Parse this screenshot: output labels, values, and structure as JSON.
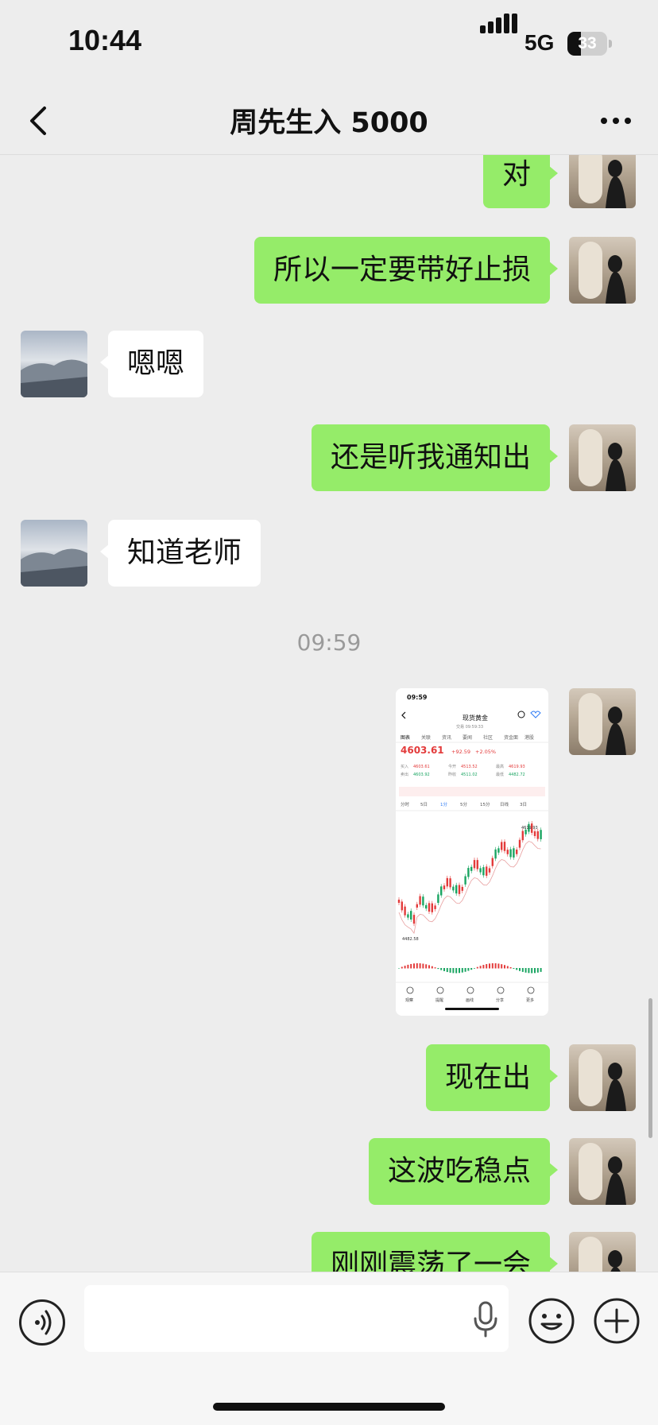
{
  "status_bar": {
    "time": "10:44",
    "network": "5G",
    "battery": "33",
    "battery_level": 0.33
  },
  "nav": {
    "title": "周先生入 5000"
  },
  "messages": [
    {
      "side": "out",
      "text": "对"
    },
    {
      "side": "out",
      "text": "所以一定要带好止损"
    },
    {
      "side": "in",
      "text": "嗯嗯"
    },
    {
      "side": "out",
      "text": "还是听我通知出"
    },
    {
      "side": "in",
      "text": "知道老师"
    },
    {
      "side": "out",
      "text": "现在出"
    },
    {
      "side": "out",
      "text": "这波吃稳点"
    },
    {
      "side": "out",
      "text": "刚刚震荡了一会"
    }
  ],
  "timestamp": "09:59",
  "screenshot": {
    "status_time": "09:59",
    "title": "现货黄金",
    "subtitle": "交易 09:59:33",
    "tabs": [
      "图表",
      "关联",
      "资讯",
      "要闻",
      "社区",
      "资金面",
      "港股"
    ],
    "price": "4603.61",
    "change": "+92.59",
    "change_pct": "+2.05%",
    "quote_labels": [
      "买入",
      "卖出",
      "今开",
      "昨收",
      "最高",
      "最低"
    ],
    "quote_values": [
      "4603.61",
      "4603.92",
      "4513.52",
      "4511.02",
      "4619.93",
      "4482.72"
    ],
    "periods": [
      "分时",
      "5日",
      "1分",
      "5分",
      "15分",
      "日线",
      "3日"
    ],
    "high_label": "4619.93",
    "low_label": "4482.58",
    "bottom_tabs": [
      "观察",
      "提醒",
      "画线",
      "分享",
      "更多"
    ],
    "colors": {
      "up": "#e33b3b",
      "down": "#1aa562",
      "accent": "#2f7bf5"
    }
  },
  "input": {
    "value": ""
  }
}
